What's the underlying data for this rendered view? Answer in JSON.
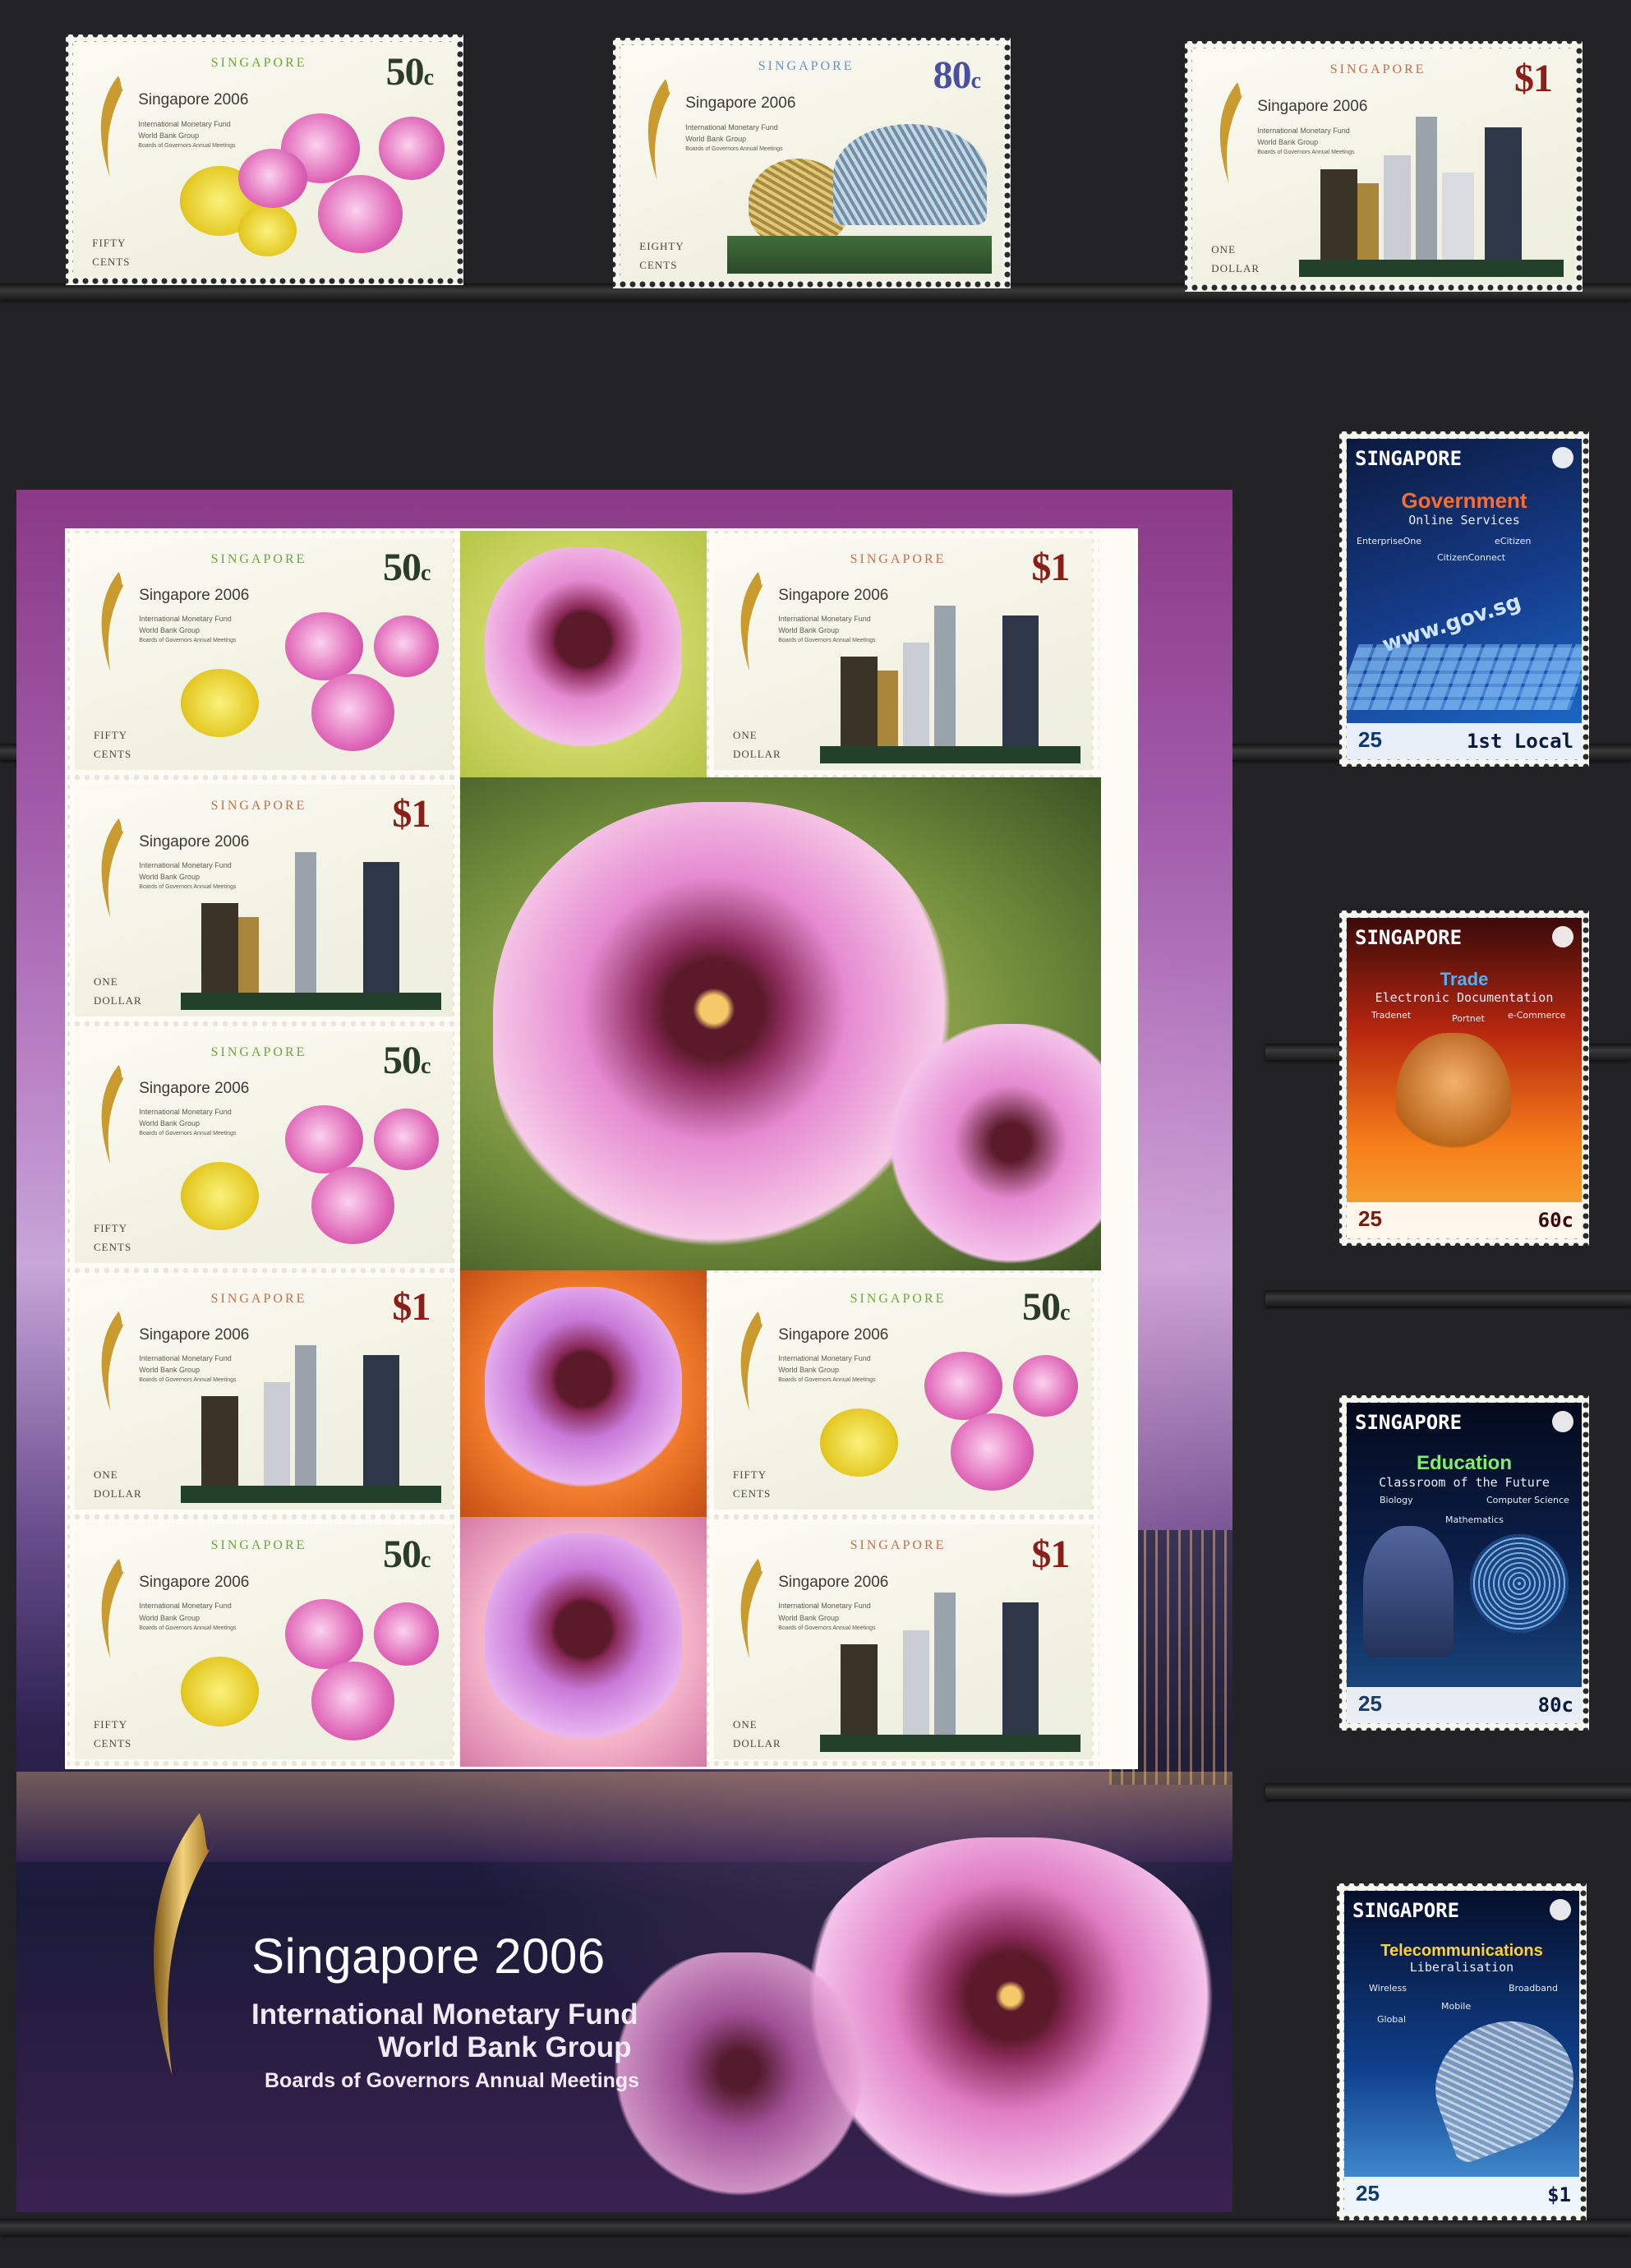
{
  "top_stamps": [
    {
      "country": "SINGAPORE",
      "value": "50",
      "unit": "c",
      "title": "Singapore 2006",
      "sub1": "International Monetary Fund",
      "sub2": "World Bank Group",
      "sub3": "Boards of Governors Annual Meetings",
      "word1": "FIFTY",
      "word2": "CENTS"
    },
    {
      "country": "SINGAPORE",
      "value": "80",
      "unit": "c",
      "title": "Singapore 2006",
      "sub1": "International Monetary Fund",
      "sub2": "World Bank Group",
      "sub3": "Boards of Governors Annual Meetings",
      "word1": "EIGHTY",
      "word2": "CENTS"
    },
    {
      "country": "SINGAPORE",
      "value": "$1",
      "unit": "",
      "title": "Singapore 2006",
      "sub1": "International Monetary Fund",
      "sub2": "World Bank Group",
      "sub3": "Boards of Governors Annual Meetings",
      "word1": "ONE",
      "word2": "DOLLAR"
    }
  ],
  "sheet_stamps": {
    "s50": {
      "country": "SINGAPORE",
      "value": "50",
      "unit": "c",
      "title": "Singapore 2006",
      "sub1": "International Monetary Fund",
      "sub2": "World Bank Group",
      "sub3": "Boards of Governors Annual Meetings",
      "word1": "FIFTY",
      "word2": "CENTS"
    },
    "s1": {
      "country": "SINGAPORE",
      "value": "$1",
      "unit": "",
      "title": "Singapore 2006",
      "sub1": "International Monetary Fund",
      "sub2": "World Bank Group",
      "sub3": "Boards of Governors Annual Meetings",
      "word1": "ONE",
      "word2": "DOLLAR"
    }
  },
  "sheet": {
    "title": "Singapore 2006",
    "line1": "International Monetary Fund",
    "line2": "World Bank Group",
    "line3": "Boards of Governors Annual Meetings"
  },
  "ict_stamps": [
    {
      "country": "SINGAPORE",
      "theme": "Government",
      "desc": "Online Services",
      "kw": [
        "EnterpriseOne",
        "eCitizen",
        "CitizenConnect",
        "www.gov.sg"
      ],
      "twentyfive": "25",
      "value": "1st Local",
      "accent": "#ff6b2a"
    },
    {
      "country": "SINGAPORE",
      "theme": "Trade",
      "desc": "Electronic Documentation",
      "kw": [
        "Tradenet",
        "Portnet",
        "e-Commerce"
      ],
      "twentyfive": "25",
      "value": "60c",
      "accent": "#4db3ff"
    },
    {
      "country": "SINGAPORE",
      "theme": "Education",
      "desc": "Classroom of the Future",
      "kw": [
        "Biology",
        "Computer Science",
        "Mathematics"
      ],
      "twentyfive": "25",
      "value": "80c",
      "accent": "#7ef06a"
    },
    {
      "country": "SINGAPORE",
      "theme": "Telecommunications",
      "desc": "Liberalisation",
      "kw": [
        "Wireless",
        "Mobile",
        "Broadband",
        "Global"
      ],
      "twentyfive": "25",
      "value": "$1",
      "accent": "#ffd23a"
    }
  ]
}
